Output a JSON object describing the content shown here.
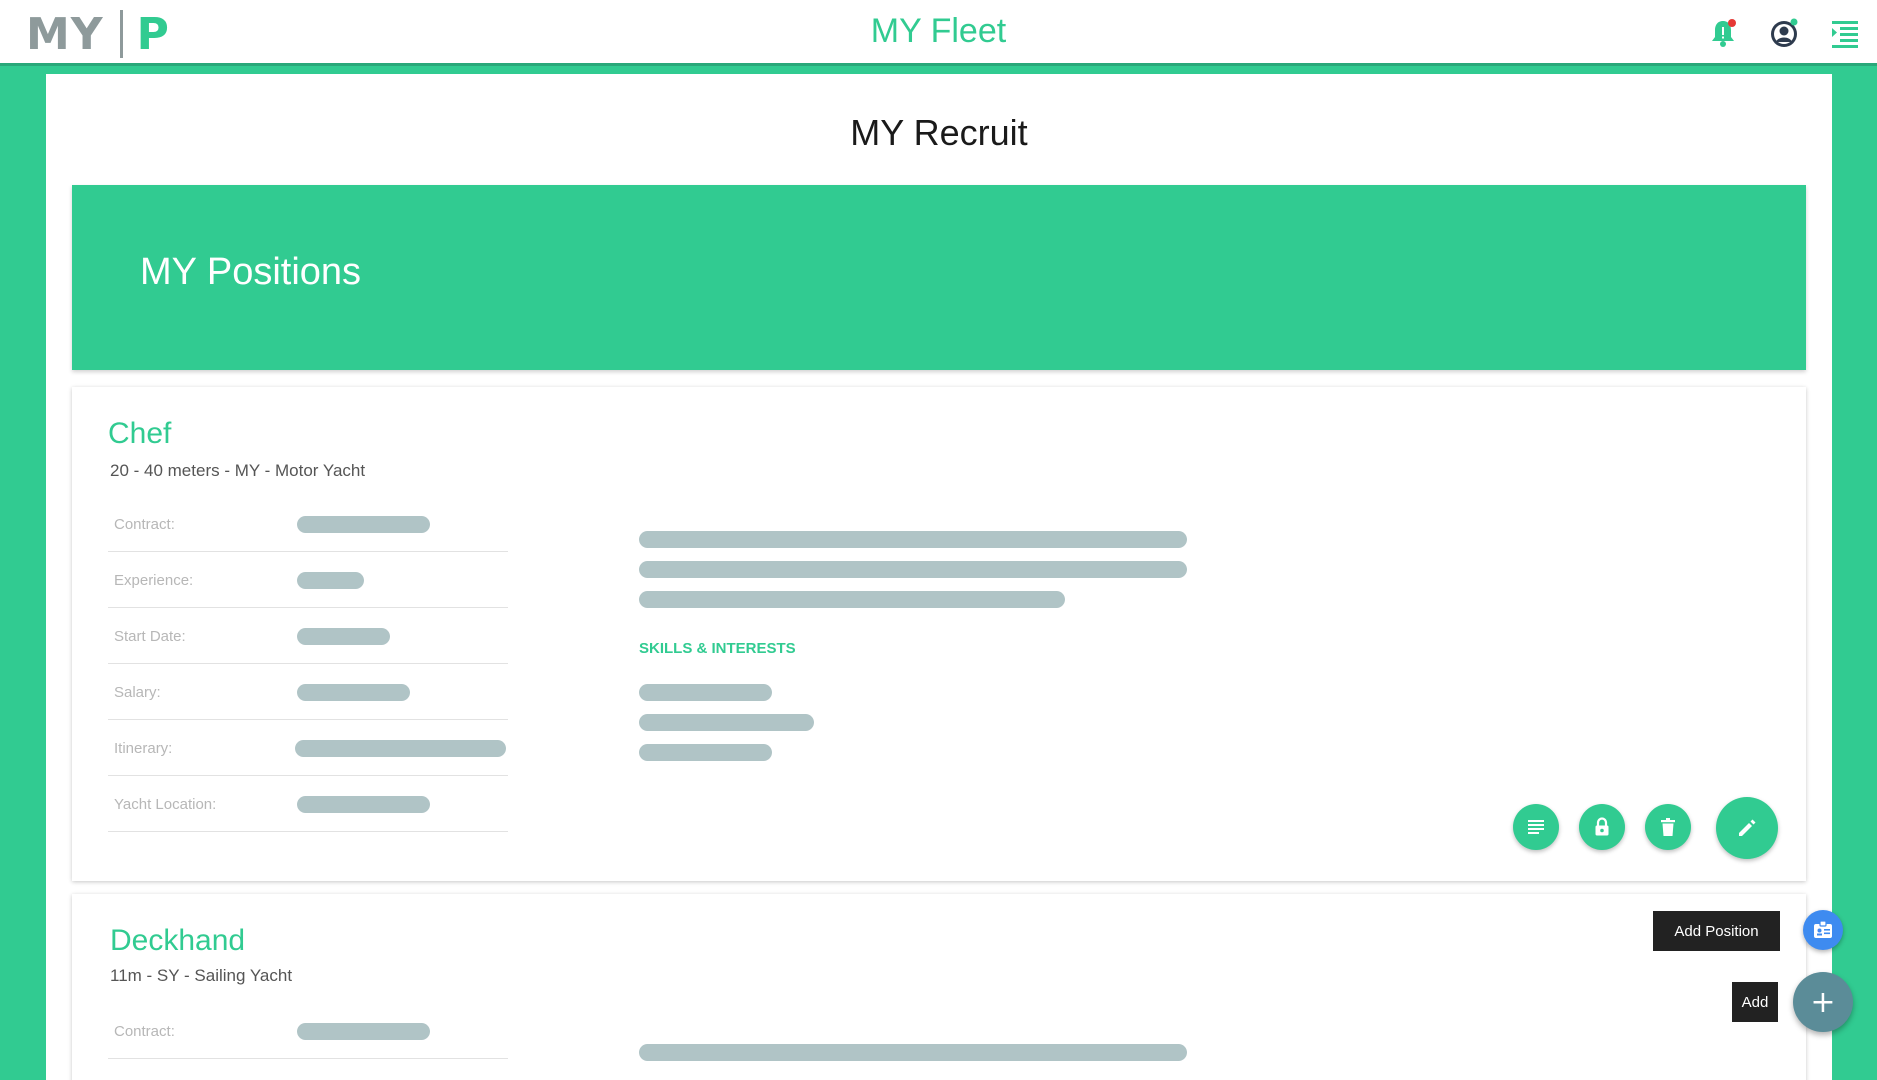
{
  "header": {
    "logo_left": "MY",
    "logo_right": "P",
    "app_title": "MY Fleet",
    "icons": [
      "bell-icon",
      "user-icon",
      "menu-icon"
    ],
    "bell_badge_color": "#e53935",
    "user_status_color": "#31cb91"
  },
  "page": {
    "title": "MY Recruit",
    "banner_title": "MY Positions"
  },
  "positions": [
    {
      "title": "Chef",
      "subtitle": "20 - 40 meters - MY - Motor Yacht",
      "fields": [
        {
          "label": "Contract:"
        },
        {
          "label": "Experience:"
        },
        {
          "label": "Start Date:"
        },
        {
          "label": "Salary:"
        },
        {
          "label": "Itinerary:"
        },
        {
          "label": "Yacht Location:"
        }
      ],
      "skills_label": "SKILLS & INTERESTS",
      "actions": [
        "description-icon",
        "lock-icon",
        "delete-icon",
        "edit-icon"
      ]
    },
    {
      "title": "Deckhand",
      "subtitle": "11m - SY - Sailing Yacht",
      "fields": [
        {
          "label": "Contract:"
        }
      ]
    }
  ],
  "fab": {
    "add_position_tooltip": "Add Position",
    "add_tooltip": "Add",
    "add_symbol": "+"
  },
  "colors": {
    "accent": "#31cb91",
    "placeholder": "#b0c4c6",
    "fab_blue": "#3e8bf0",
    "fab_slate": "#5b8c98"
  }
}
